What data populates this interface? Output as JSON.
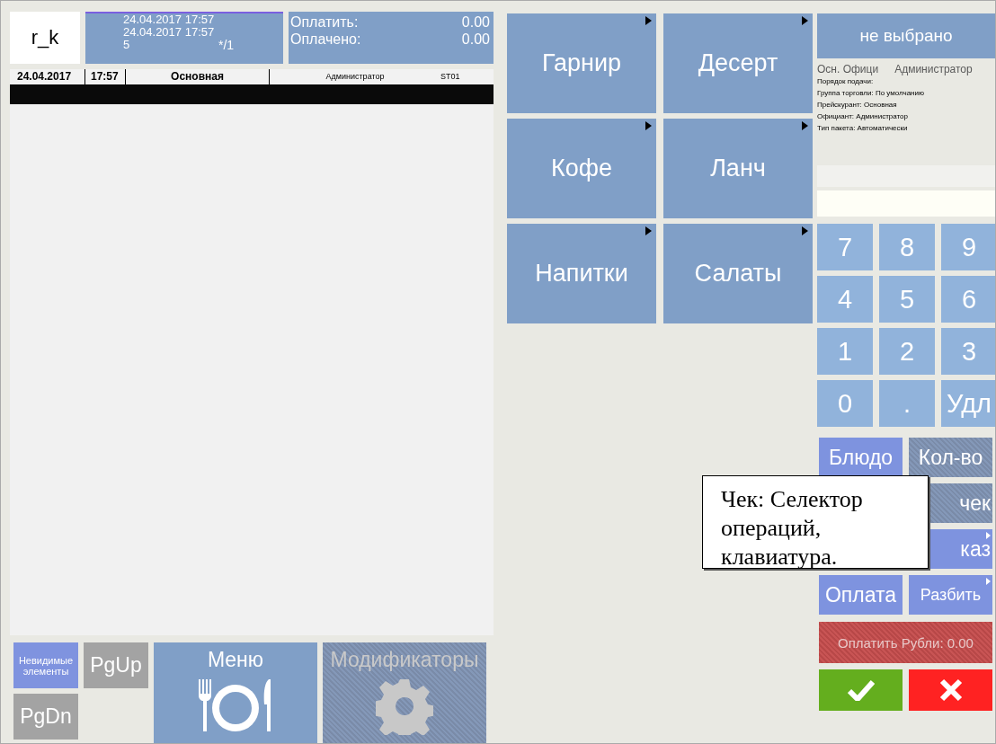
{
  "header": {
    "logo": "r_k",
    "session": {
      "lines": [
        "24.04.2017 17:57",
        "24.04.2017 17:57",
        "5"
      ],
      "counter": "*/1"
    },
    "totals": [
      {
        "label": "Оплатить:",
        "value": "0.00"
      },
      {
        "label": "Оплачено:",
        "value": "0.00"
      }
    ]
  },
  "order_header": {
    "date": "24.04.2017",
    "time": "17:57",
    "price_list": "Основная",
    "waiter": "Администратор",
    "station": "ST01"
  },
  "categories": [
    {
      "label": "Гарнир",
      "submenu": true
    },
    {
      "label": "Десерт",
      "submenu": true
    },
    {
      "label": "Кофе",
      "submenu": true
    },
    {
      "label": "Ланч",
      "submenu": true
    },
    {
      "label": "Напитки",
      "submenu": true
    },
    {
      "label": "Салаты",
      "submenu": true
    }
  ],
  "selector": "не выбрано",
  "info": {
    "title": "Осн. Офици",
    "user": "Администратор",
    "lines": [
      "Порядок подачи:",
      "Группа торговли: По умолчанию",
      "Прейскурант: Основная",
      "Официант: Администратор",
      "Тип пакета: Автоматически"
    ]
  },
  "keypad": [
    "7",
    "8",
    "9",
    "4",
    "5",
    "6",
    "1",
    "2",
    "3",
    "0",
    ".",
    "Удл"
  ],
  "operations": [
    {
      "label": "Блюдо",
      "disabled": false,
      "submenu": false
    },
    {
      "label": "Кол-во",
      "disabled": true,
      "submenu": false
    },
    {
      "label": "чек",
      "disabled": true,
      "submenu": false
    },
    {
      "label": "каз",
      "disabled": false,
      "submenu": true
    },
    {
      "label": "Оплата",
      "disabled": false,
      "submenu": false
    },
    {
      "label": "Разбить",
      "disabled": false,
      "submenu": true
    }
  ],
  "pay_button": {
    "label": "Оплатить Рубли: 0.00",
    "disabled": true
  },
  "bottom": {
    "hidden_items": "Невидимые элементы",
    "page_up": "PgUp",
    "page_down": "PgDn",
    "menu": {
      "label": "Меню",
      "disabled": false
    },
    "modifiers": {
      "label": "Модификаторы",
      "disabled": true
    }
  },
  "callout": "Чек: Селектор операций, клавиатура."
}
